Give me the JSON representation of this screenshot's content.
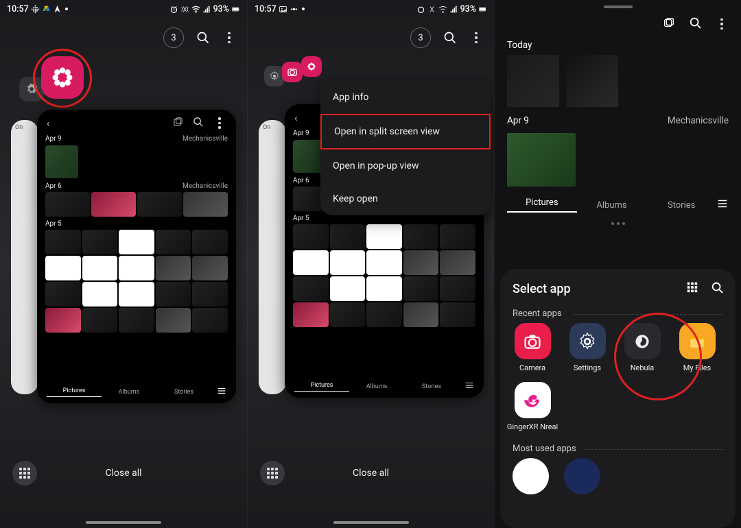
{
  "status": {
    "time": "10:57",
    "battery": "93%"
  },
  "recents": {
    "tab_count": "3",
    "close_all": "Close all"
  },
  "gallery_card": {
    "dates": {
      "d1": "Apr 9",
      "d2": "Apr 6",
      "d3": "Apr 5"
    },
    "location": "Mechanicsville",
    "tabs": {
      "pictures": "Pictures",
      "albums": "Albums",
      "stories": "Stories"
    },
    "behind_label": "On"
  },
  "menu": {
    "app_info": "App info",
    "split": "Open in split screen view",
    "popup": "Open in pop-up view",
    "keep": "Keep open"
  },
  "p3": {
    "today": "Today",
    "date": "Apr 9",
    "location": "Mechanicsville",
    "tabs": {
      "pictures": "Pictures",
      "albums": "Albums",
      "stories": "Stories"
    }
  },
  "sheet": {
    "title": "Select app",
    "recent": "Recent apps",
    "mostused": "Most used apps",
    "apps": {
      "camera": "Camera",
      "settings": "Settings",
      "nebula": "Nebula",
      "myfiles": "My Files",
      "gingerxr": "GingerXR Nreal"
    }
  }
}
